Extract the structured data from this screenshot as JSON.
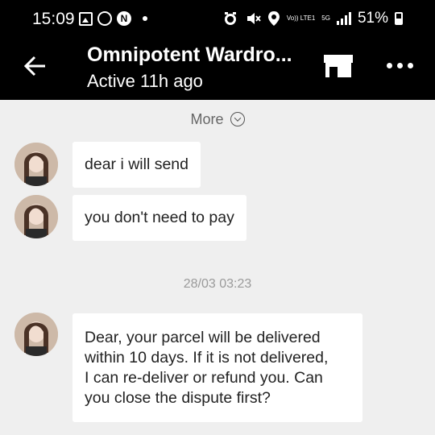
{
  "status_bar": {
    "time": "15:09",
    "battery": "51%",
    "volte_label": "Vo)) LTE1",
    "network_label": "5G"
  },
  "header": {
    "title": "Omnipotent Wardro...",
    "subtitle": "Active 11h ago"
  },
  "history": {
    "more_label": "More"
  },
  "messages": [
    {
      "text": "dear i will send"
    },
    {
      "text": "you don't need to pay"
    }
  ],
  "timestamp": "28/03 03:23",
  "last_message": {
    "lines": [
      "Dear, your parcel will be delivered",
      "within 10 days. If it is not delivered,",
      "I can re-deliver or refund you. Can",
      "you close the dispute first?"
    ]
  },
  "colors": {
    "topbar_bg": "#000000",
    "chat_bg": "#efefef",
    "bubble_bg": "#ffffff"
  }
}
